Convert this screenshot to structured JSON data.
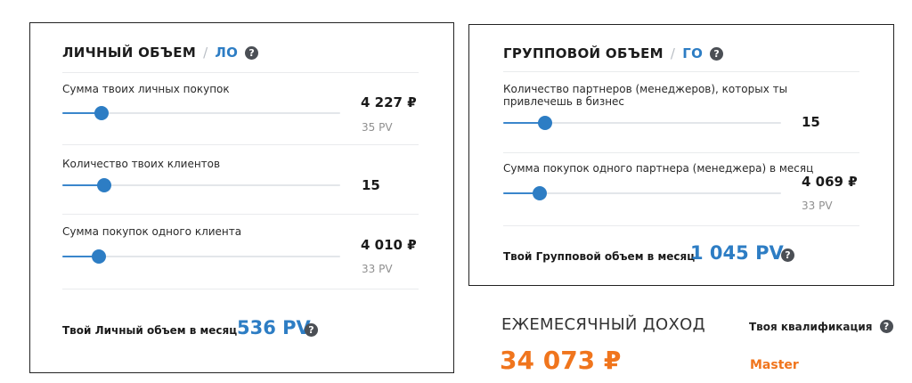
{
  "personal": {
    "title": "ЛИЧНЫЙ ОБЪЕМ",
    "separator": "/",
    "abbr": "ЛО",
    "help_glyph": "?",
    "rows": [
      {
        "label": "Сумма твоих личных покупок",
        "value": "4 227 ₽",
        "sub": "35 PV",
        "level": 0.14
      },
      {
        "label": "Количество твоих клиентов",
        "value": "15",
        "sub": "",
        "level": 0.15
      },
      {
        "label": "Сумма покупок одного клиента",
        "value": "4 010 ₽",
        "sub": "33 PV",
        "level": 0.13
      }
    ],
    "total_label": "Твой Личный объем в месяц",
    "total_value": "536 PV"
  },
  "group": {
    "title": "ГРУППОВОЙ ОБЪЕМ",
    "separator": "/",
    "abbr": "ГО",
    "help_glyph": "?",
    "rows": [
      {
        "label": "Количество партнеров (менеджеров), которых ты привлечешь в бизнес",
        "value": "15",
        "sub": "",
        "level": 0.15
      },
      {
        "label": "Сумма покупок одного партнера (менеджера) в месяц",
        "value": "4 069 ₽",
        "sub": "33 PV",
        "level": 0.13
      }
    ],
    "total_label": "Твой Групповой объем в месяц",
    "total_value": "1 045 PV"
  },
  "income": {
    "title": "ЕЖЕМЕСЯЧНЫЙ ДОХОД",
    "value": "34 073 ₽"
  },
  "qualification": {
    "label": "Твоя квалификация",
    "help_glyph": "?",
    "value": "Master"
  },
  "colors": {
    "accent_blue": "#2d7dc4",
    "accent_orange": "#f0751d",
    "border": "#222222"
  }
}
